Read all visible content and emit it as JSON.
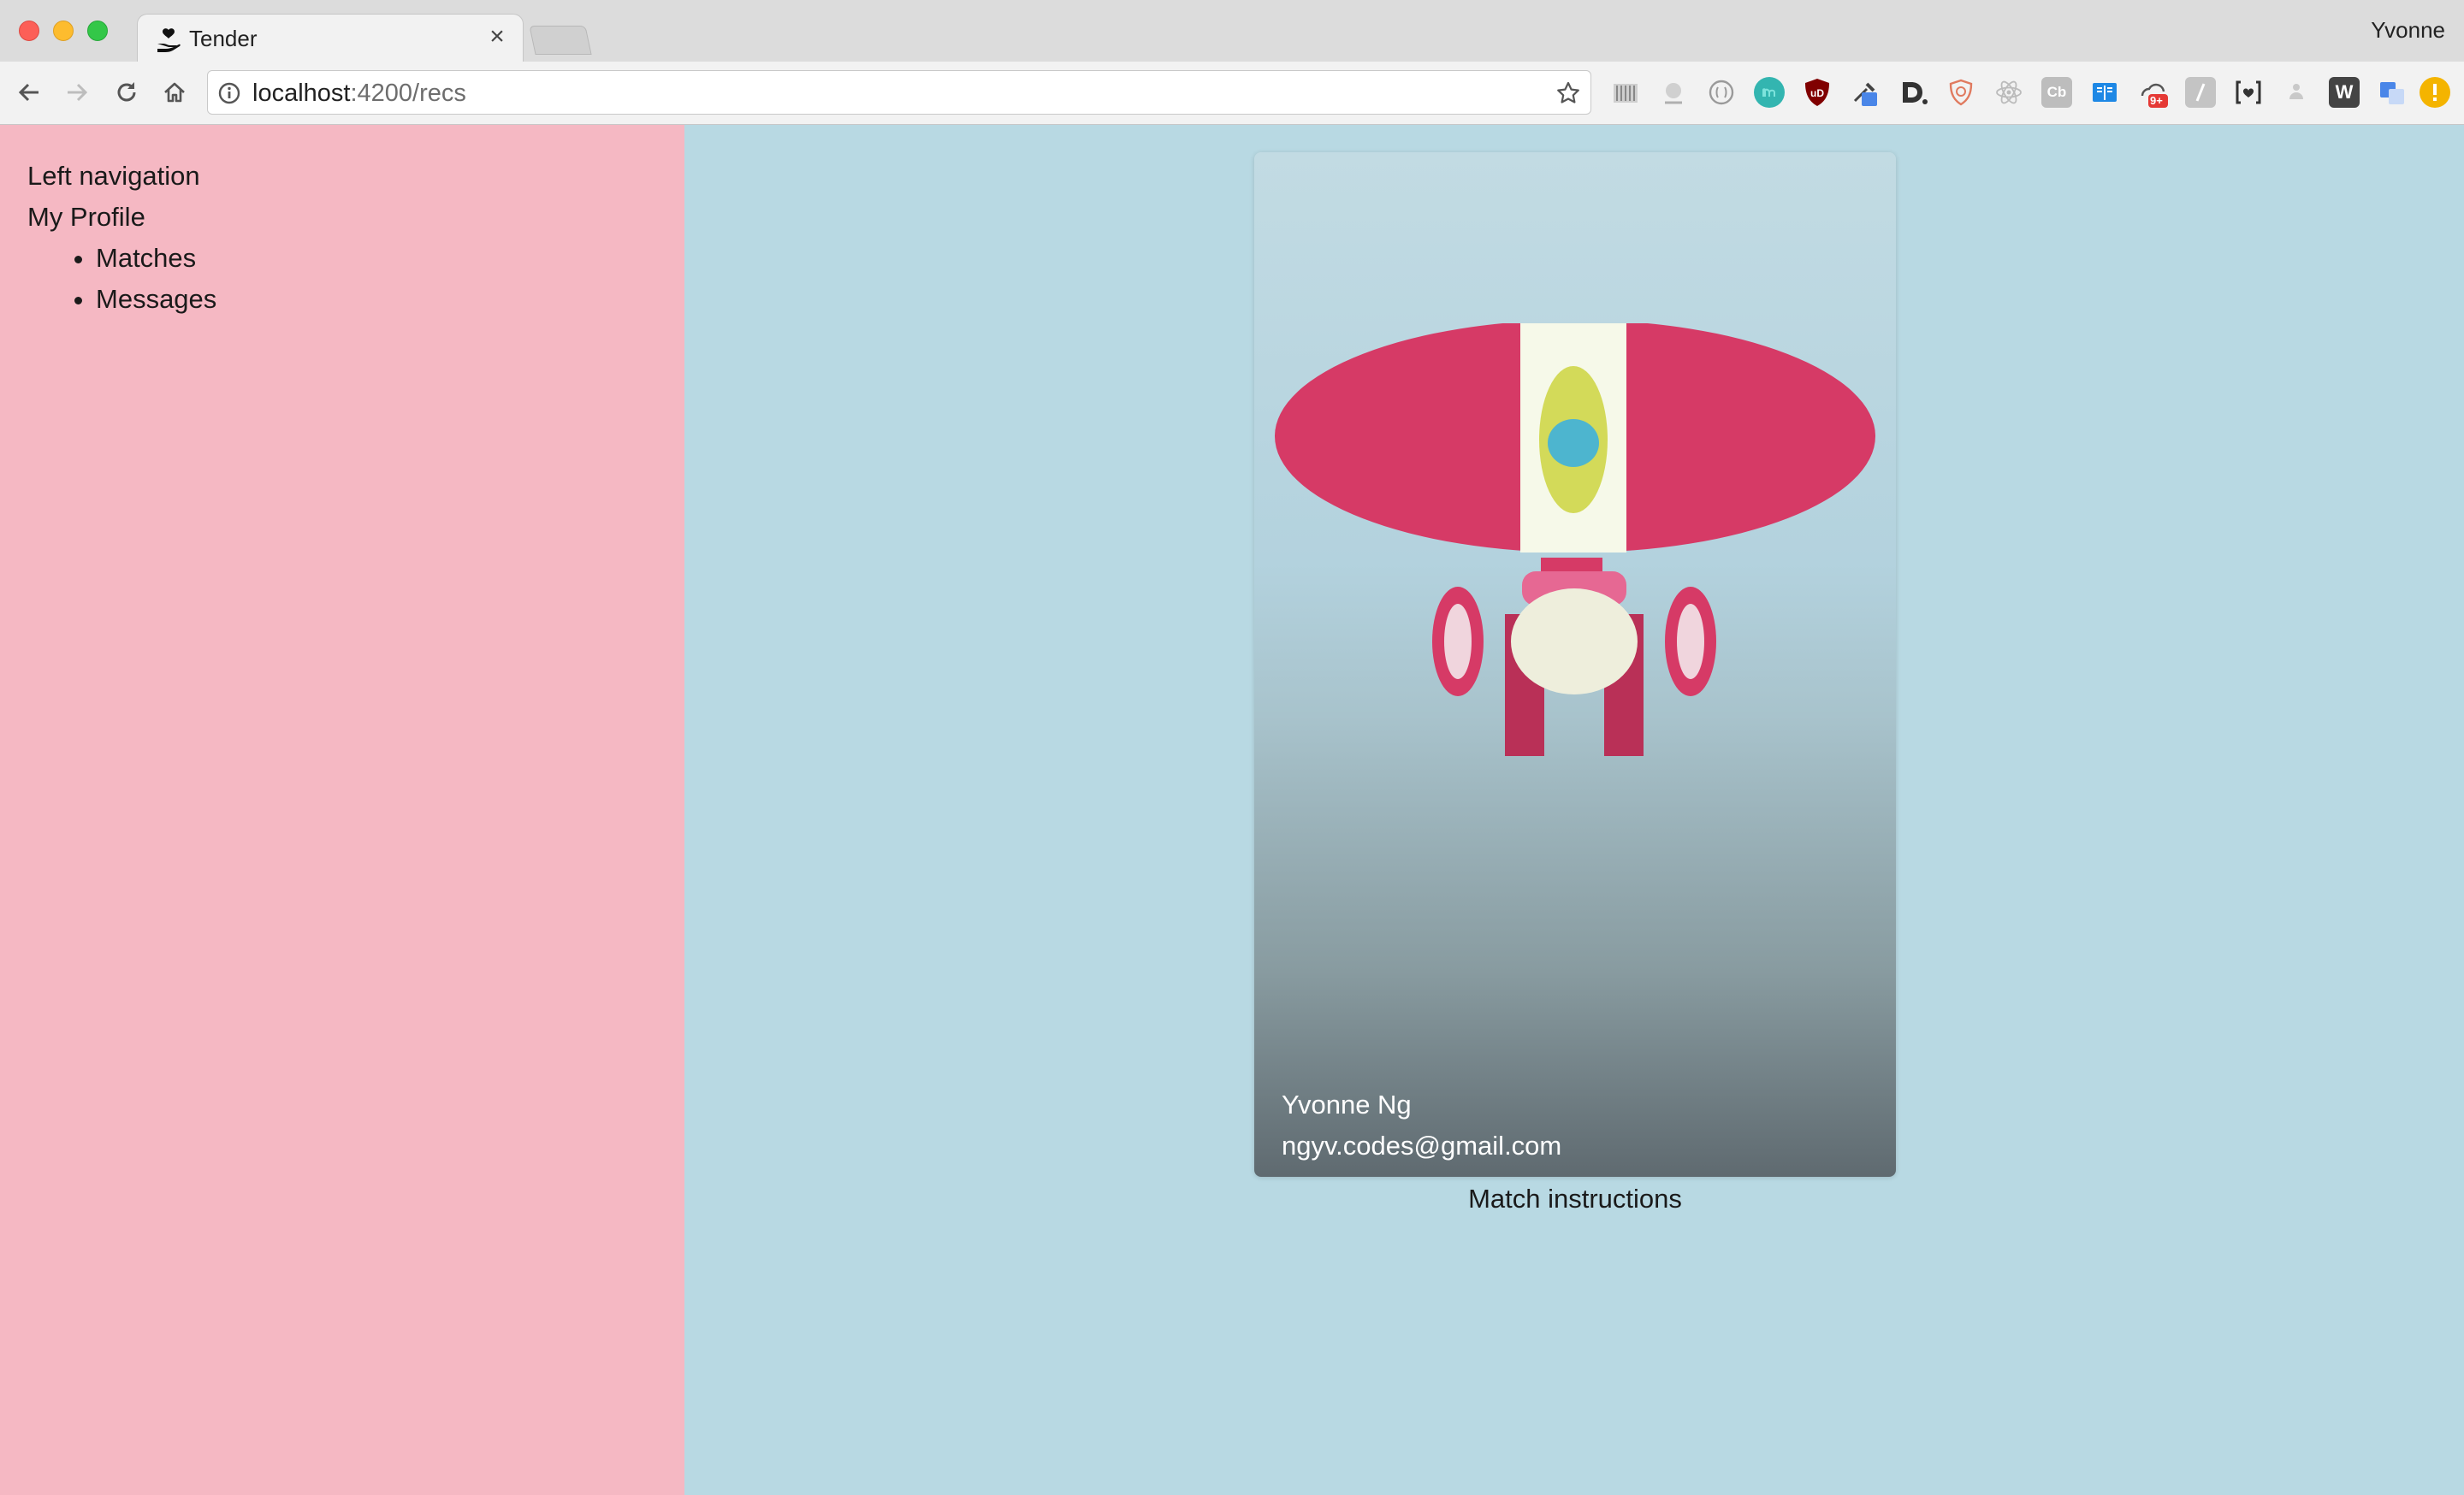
{
  "browser": {
    "tab": {
      "title": "Tender",
      "close_glyph": "×",
      "favicon": "hand-heart-icon"
    },
    "profile_name": "Yvonne",
    "address": {
      "host": "localhost",
      "path": ":4200/recs"
    },
    "extensions": [
      "pocket",
      "sloth",
      "lens",
      "mint-circle",
      "ublock-origin",
      "eyedropper",
      "dash",
      "brave-shield",
      "react-devtools",
      "cb",
      "reader",
      "cloud-badge",
      "slash",
      "brackets-heart",
      "users",
      "w",
      "translate",
      "alert"
    ],
    "extension_labels": {
      "cb": "Cb",
      "w": "W",
      "badge": "9+"
    }
  },
  "sidebar": {
    "heading": "Left navigation",
    "profile_link": "My Profile",
    "items": [
      {
        "label": "Matches"
      },
      {
        "label": "Messages"
      }
    ]
  },
  "card": {
    "name": "Yvonne Ng",
    "email": "ngyv.codes@gmail.com"
  },
  "instructions": "Match instructions",
  "colors": {
    "sidebar_bg": "#f5b8c3",
    "main_bg": "#b8d9e3",
    "avatar_red": "#d63a66",
    "avatar_cream": "#f6f9e9",
    "avatar_yellow": "#d3da59",
    "avatar_blue": "#4db5cf"
  }
}
